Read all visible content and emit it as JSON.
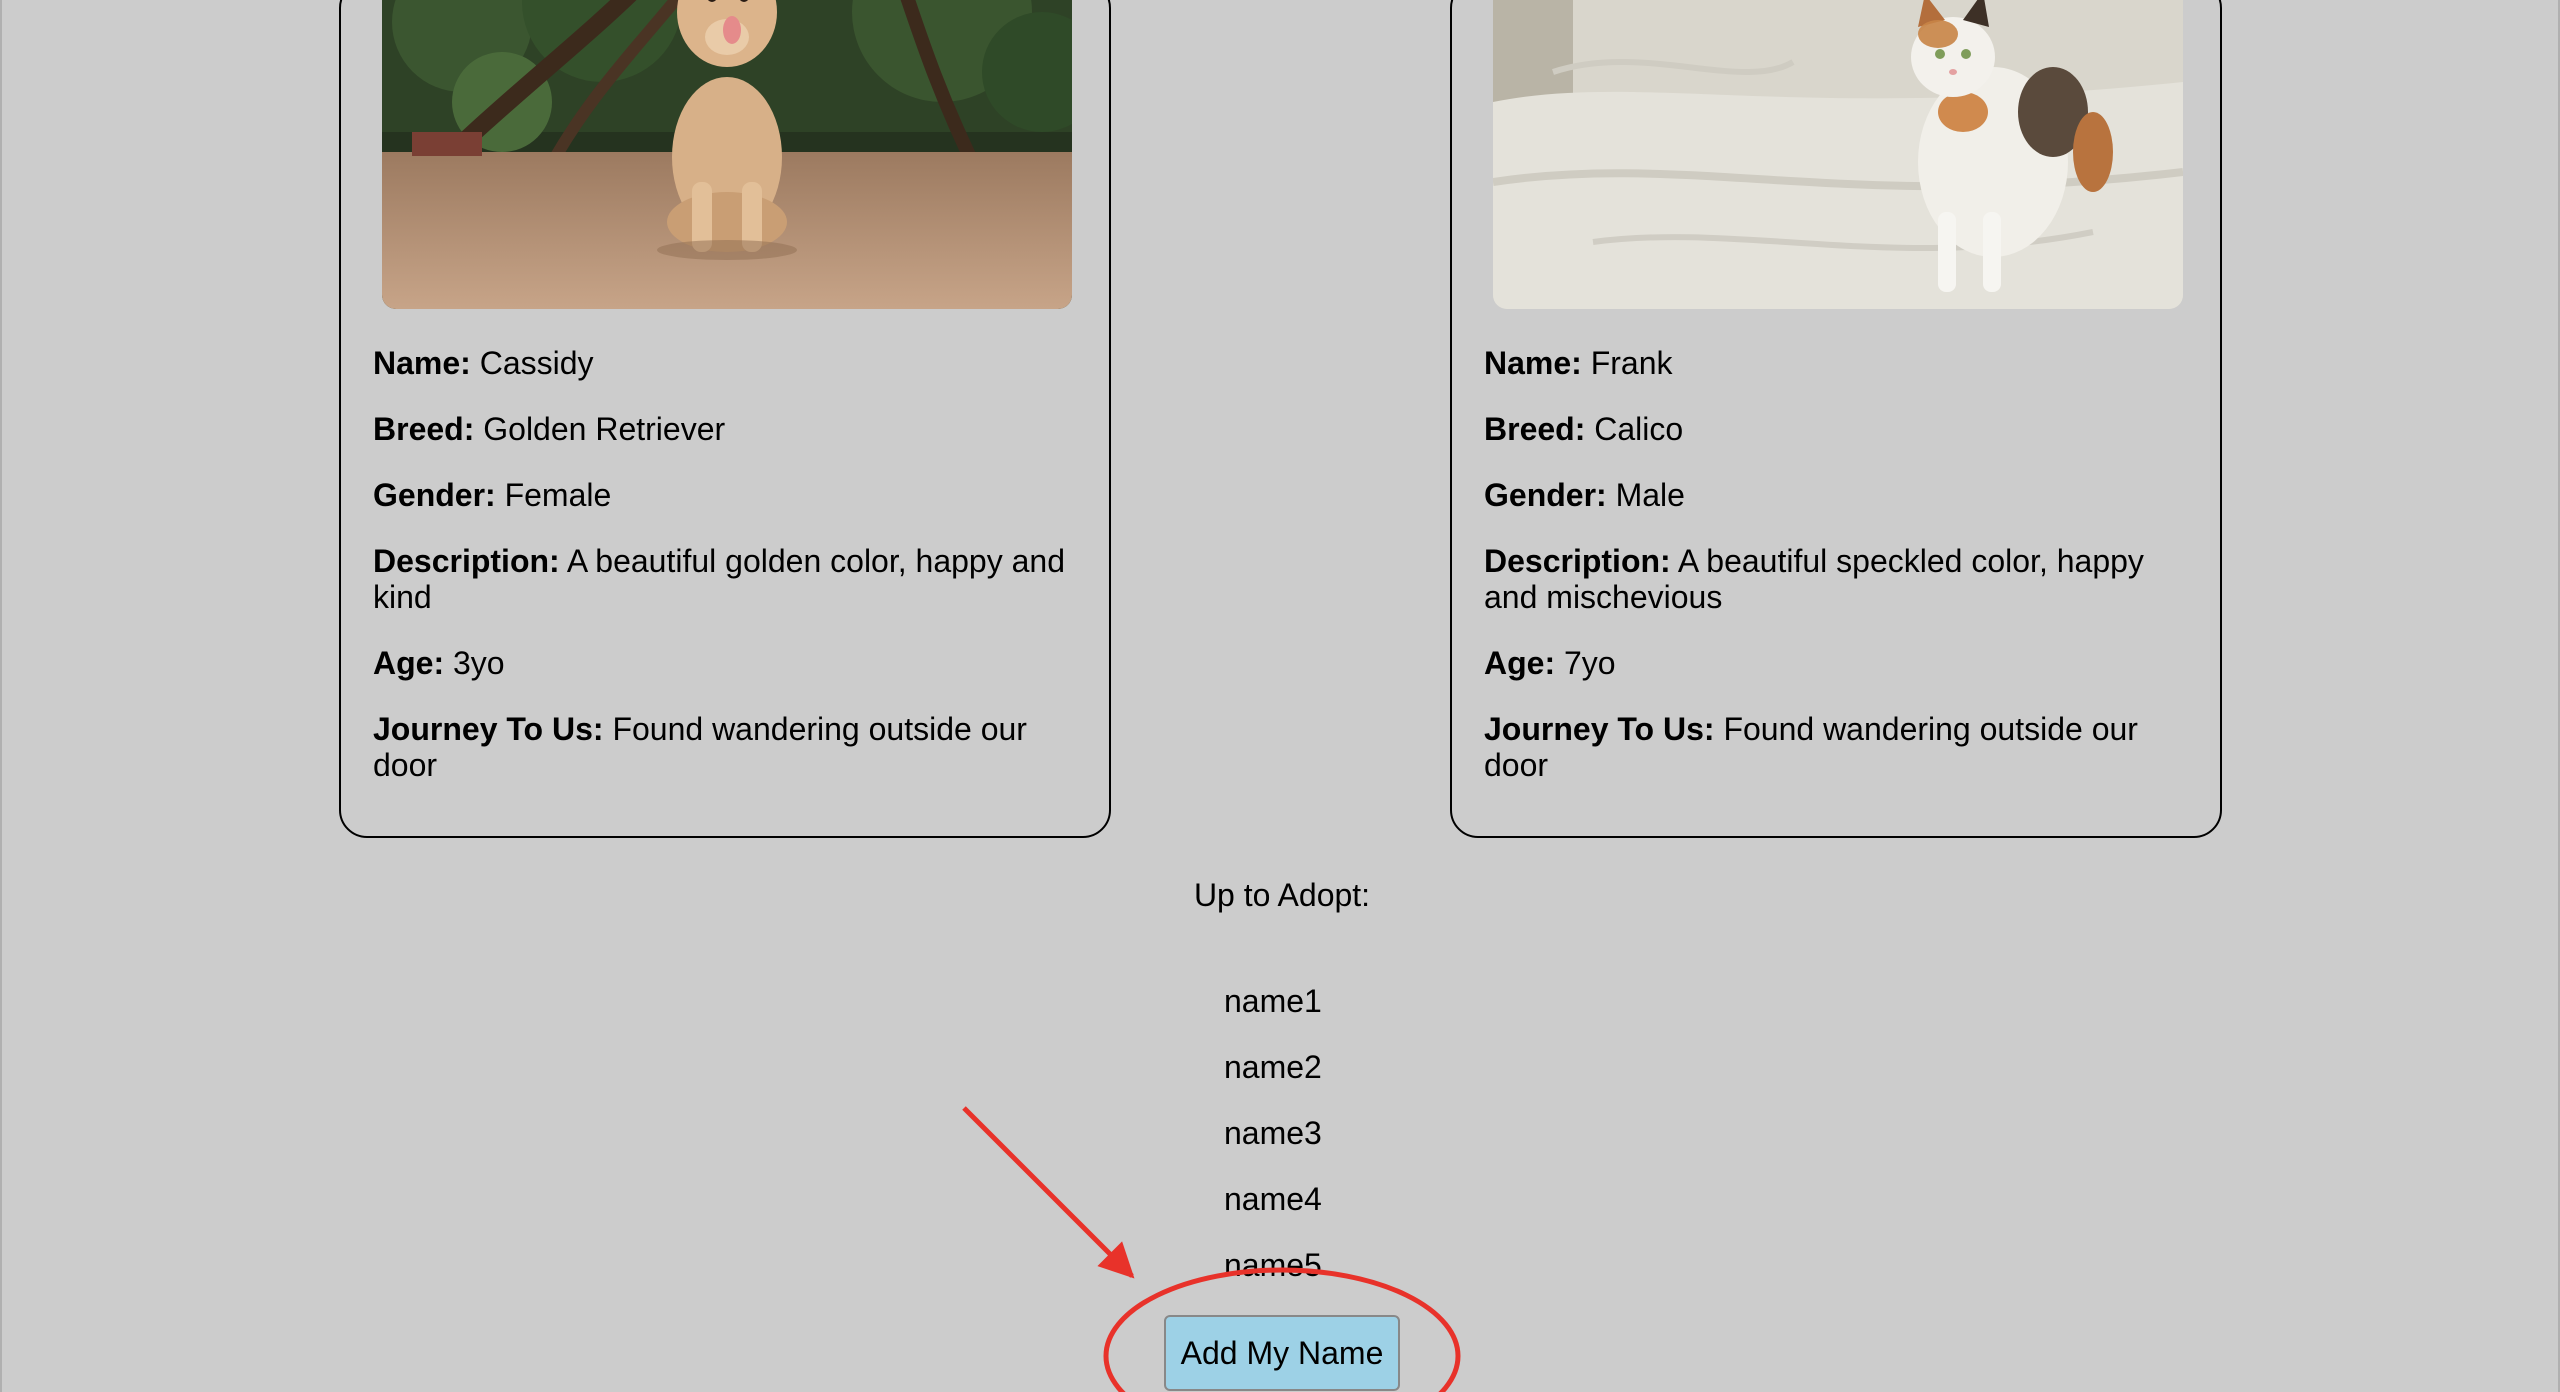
{
  "pets": [
    {
      "photo_icon": "golden-retriever-photo",
      "name_label": "Name:",
      "name": "Cassidy",
      "breed_label": "Breed:",
      "breed": "Golden Retriever",
      "gender_label": "Gender:",
      "gender": "Female",
      "description_label": "Description:",
      "description": "A beautiful golden color, happy and kind",
      "age_label": "Age:",
      "age": "3yo",
      "journey_label": "Journey To Us:",
      "journey": "Found wandering outside our door"
    },
    {
      "photo_icon": "calico-cat-photo",
      "name_label": "Name:",
      "name": "Frank",
      "breed_label": "Breed:",
      "breed": "Calico",
      "gender_label": "Gender:",
      "gender": "Male",
      "description_label": "Description:",
      "description": "A beautiful speckled color, happy and mischevious",
      "age_label": "Age:",
      "age": "7yo",
      "journey_label": "Journey To Us:",
      "journey": "Found wandering outside our door"
    }
  ],
  "adopt": {
    "title": "Up to Adopt:",
    "names": [
      "name1",
      "name2",
      "name3",
      "name4",
      "name5"
    ],
    "button_label": "Add My Name"
  },
  "colors": {
    "background": "#cccccc",
    "button": "#9dd1e6",
    "annotation": "#e8322a"
  }
}
